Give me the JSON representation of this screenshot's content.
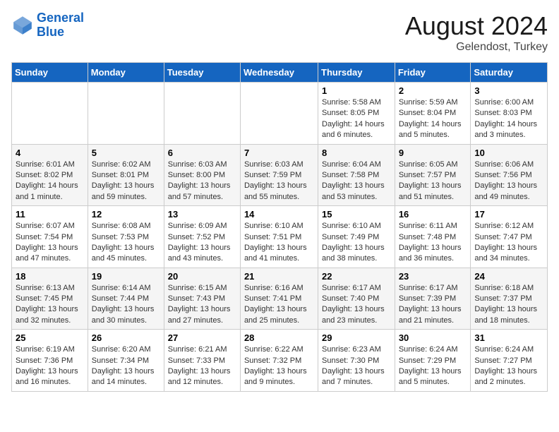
{
  "logo": {
    "line1": "General",
    "line2": "Blue"
  },
  "title": "August 2024",
  "location": "Gelendost, Turkey",
  "days_of_week": [
    "Sunday",
    "Monday",
    "Tuesday",
    "Wednesday",
    "Thursday",
    "Friday",
    "Saturday"
  ],
  "weeks": [
    [
      {
        "day": "",
        "info": ""
      },
      {
        "day": "",
        "info": ""
      },
      {
        "day": "",
        "info": ""
      },
      {
        "day": "",
        "info": ""
      },
      {
        "day": "1",
        "info": "Sunrise: 5:58 AM\nSunset: 8:05 PM\nDaylight: 14 hours\nand 6 minutes."
      },
      {
        "day": "2",
        "info": "Sunrise: 5:59 AM\nSunset: 8:04 PM\nDaylight: 14 hours\nand 5 minutes."
      },
      {
        "day": "3",
        "info": "Sunrise: 6:00 AM\nSunset: 8:03 PM\nDaylight: 14 hours\nand 3 minutes."
      }
    ],
    [
      {
        "day": "4",
        "info": "Sunrise: 6:01 AM\nSunset: 8:02 PM\nDaylight: 14 hours\nand 1 minute."
      },
      {
        "day": "5",
        "info": "Sunrise: 6:02 AM\nSunset: 8:01 PM\nDaylight: 13 hours\nand 59 minutes."
      },
      {
        "day": "6",
        "info": "Sunrise: 6:03 AM\nSunset: 8:00 PM\nDaylight: 13 hours\nand 57 minutes."
      },
      {
        "day": "7",
        "info": "Sunrise: 6:03 AM\nSunset: 7:59 PM\nDaylight: 13 hours\nand 55 minutes."
      },
      {
        "day": "8",
        "info": "Sunrise: 6:04 AM\nSunset: 7:58 PM\nDaylight: 13 hours\nand 53 minutes."
      },
      {
        "day": "9",
        "info": "Sunrise: 6:05 AM\nSunset: 7:57 PM\nDaylight: 13 hours\nand 51 minutes."
      },
      {
        "day": "10",
        "info": "Sunrise: 6:06 AM\nSunset: 7:56 PM\nDaylight: 13 hours\nand 49 minutes."
      }
    ],
    [
      {
        "day": "11",
        "info": "Sunrise: 6:07 AM\nSunset: 7:54 PM\nDaylight: 13 hours\nand 47 minutes."
      },
      {
        "day": "12",
        "info": "Sunrise: 6:08 AM\nSunset: 7:53 PM\nDaylight: 13 hours\nand 45 minutes."
      },
      {
        "day": "13",
        "info": "Sunrise: 6:09 AM\nSunset: 7:52 PM\nDaylight: 13 hours\nand 43 minutes."
      },
      {
        "day": "14",
        "info": "Sunrise: 6:10 AM\nSunset: 7:51 PM\nDaylight: 13 hours\nand 41 minutes."
      },
      {
        "day": "15",
        "info": "Sunrise: 6:10 AM\nSunset: 7:49 PM\nDaylight: 13 hours\nand 38 minutes."
      },
      {
        "day": "16",
        "info": "Sunrise: 6:11 AM\nSunset: 7:48 PM\nDaylight: 13 hours\nand 36 minutes."
      },
      {
        "day": "17",
        "info": "Sunrise: 6:12 AM\nSunset: 7:47 PM\nDaylight: 13 hours\nand 34 minutes."
      }
    ],
    [
      {
        "day": "18",
        "info": "Sunrise: 6:13 AM\nSunset: 7:45 PM\nDaylight: 13 hours\nand 32 minutes."
      },
      {
        "day": "19",
        "info": "Sunrise: 6:14 AM\nSunset: 7:44 PM\nDaylight: 13 hours\nand 30 minutes."
      },
      {
        "day": "20",
        "info": "Sunrise: 6:15 AM\nSunset: 7:43 PM\nDaylight: 13 hours\nand 27 minutes."
      },
      {
        "day": "21",
        "info": "Sunrise: 6:16 AM\nSunset: 7:41 PM\nDaylight: 13 hours\nand 25 minutes."
      },
      {
        "day": "22",
        "info": "Sunrise: 6:17 AM\nSunset: 7:40 PM\nDaylight: 13 hours\nand 23 minutes."
      },
      {
        "day": "23",
        "info": "Sunrise: 6:17 AM\nSunset: 7:39 PM\nDaylight: 13 hours\nand 21 minutes."
      },
      {
        "day": "24",
        "info": "Sunrise: 6:18 AM\nSunset: 7:37 PM\nDaylight: 13 hours\nand 18 minutes."
      }
    ],
    [
      {
        "day": "25",
        "info": "Sunrise: 6:19 AM\nSunset: 7:36 PM\nDaylight: 13 hours\nand 16 minutes."
      },
      {
        "day": "26",
        "info": "Sunrise: 6:20 AM\nSunset: 7:34 PM\nDaylight: 13 hours\nand 14 minutes."
      },
      {
        "day": "27",
        "info": "Sunrise: 6:21 AM\nSunset: 7:33 PM\nDaylight: 13 hours\nand 12 minutes."
      },
      {
        "day": "28",
        "info": "Sunrise: 6:22 AM\nSunset: 7:32 PM\nDaylight: 13 hours\nand 9 minutes."
      },
      {
        "day": "29",
        "info": "Sunrise: 6:23 AM\nSunset: 7:30 PM\nDaylight: 13 hours\nand 7 minutes."
      },
      {
        "day": "30",
        "info": "Sunrise: 6:24 AM\nSunset: 7:29 PM\nDaylight: 13 hours\nand 5 minutes."
      },
      {
        "day": "31",
        "info": "Sunrise: 6:24 AM\nSunset: 7:27 PM\nDaylight: 13 hours\nand 2 minutes."
      }
    ]
  ]
}
